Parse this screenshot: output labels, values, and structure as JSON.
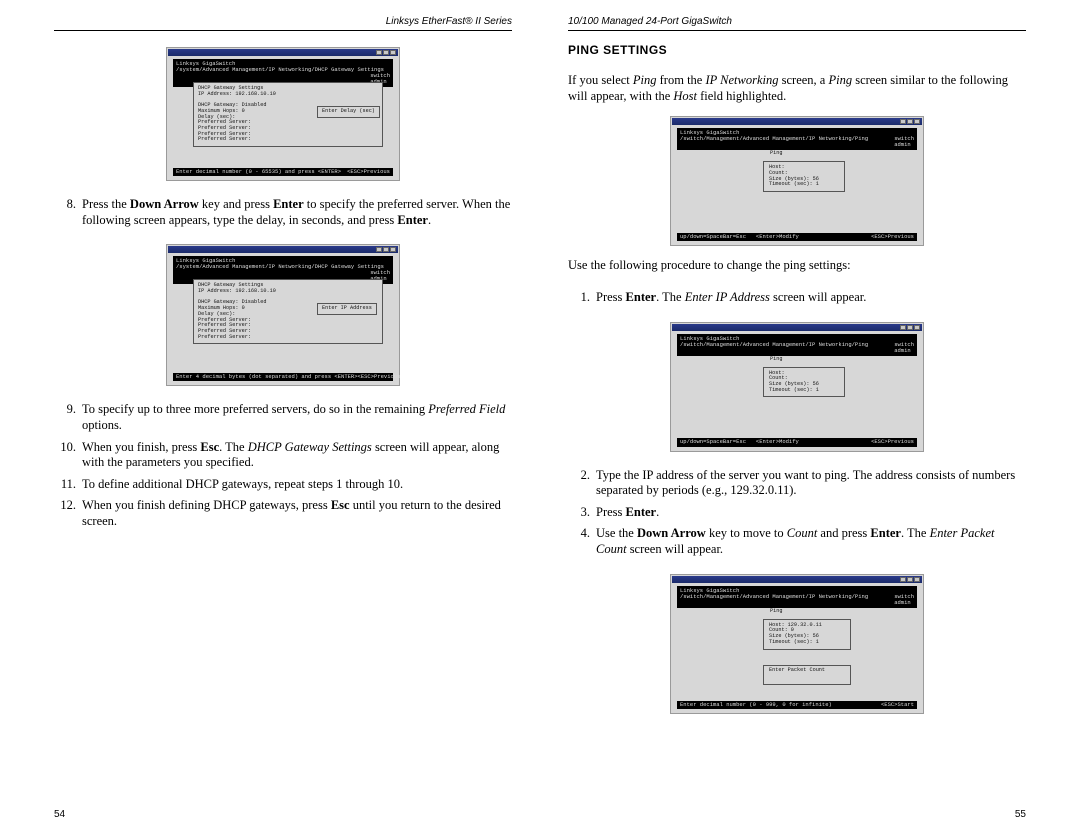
{
  "left": {
    "running_head": "Linksys EtherFast® II Series",
    "page_num": "54",
    "shot1": {
      "head_l": "Linksys GigaSwitch\\n/system/Advanced Management/IP Networking/DHCP Gateway Settings",
      "head_r": "switch\\nadmin",
      "box": "DHCP Gateway Settings\\nIP Address: 192.168.10.10\\n\\nDHCP Gateway: Disabled\\nMaximum Hops: 0\\nDelay (sec): \\nPreferred Server:\\nPreferred Server:\\nPreferred Server:\\nPreferred Server:",
      "edit": "Enter Delay (sec)",
      "status_l": "Enter decimal number (0 - 65535) and press <ENTER>",
      "status_r": "<ESC>Previous"
    },
    "step8": "Press the Down Arrow key and press Enter to specify the preferred server. When the following screen appears, type the delay, in seconds, and press Enter.",
    "shot2": {
      "head_l": "Linksys GigaSwitch\\n/system/Advanced Management/IP Networking/DHCP Gateway Settings",
      "head_r": "switch\\nadmin",
      "box": "DHCP Gateway Settings\\nIP Address: 192.168.10.10\\n\\nDHCP Gateway: Disabled\\nMaximum Hops: 0\\nDelay (sec):\\nPreferred Server:\\nPreferred Server:\\nPreferred Server:\\nPreferred Server:",
      "edit": "Enter IP Address",
      "status_l": "Enter 4 decimal bytes (dot separated) and press <ENTER>",
      "status_r": "<ESC>Previous"
    },
    "step9": "To specify up to three more preferred servers, do so in the remaining Preferred Field options.",
    "step10": "When you finish, press Esc. The DHCP Gateway Settings screen will appear, along with the parameters you specified.",
    "step11": "To define additional DHCP gateways, repeat steps 1 through 10.",
    "step12": "When you finish defining DHCP gateways, press Esc until you return to the desired screen."
  },
  "right": {
    "running_head": "10/100 Managed 24-Port GigaSwitch",
    "page_num": "55",
    "title": "PING SETTINGS",
    "intro": "If you select Ping from the IP Networking screen, a Ping screen similar to the following will appear, with the Host field highlighted.",
    "shotA": {
      "head_l": "Linksys GigaSwitch\\n/switch/Management/Advanced Management/IP Networking/Ping",
      "head_r": "switch\\nadmin",
      "group_title": "Ping",
      "box": "Host:\\nCount:\\nSize (bytes): 56\\nTimeout (sec): 1",
      "status_l": "up/down=SpaceBar=Esc   <Enter>Modify",
      "status_r": "<ESC>Previous"
    },
    "lead": "Use the following procedure to change the ping settings:",
    "step1": "Press Enter. The Enter IP Address screen will appear.",
    "shotB": {
      "head_l": "Linksys GigaSwitch\\n/switch/Management/Advanced Management/IP Networking/Ping",
      "head_r": "switch\\nadmin",
      "group_title": "Ping",
      "box": "Host:\\nCount:\\nSize (bytes): 56\\nTimeout (sec): 1",
      "status_l": "up/down=SpaceBar=Esc   <Enter>Modify",
      "status_r": "<ESC>Previous"
    },
    "step2": "Type the IP address of the server you want to ping. The address consists of numbers separated by periods (e.g., 129.32.0.11).",
    "step3": "Press Enter.",
    "step4": "Use the Down Arrow key to move to Count and press Enter. The Enter Packet Count screen will appear.",
    "shotC": {
      "head_l": "Linksys GigaSwitch\\n/switch/Management/Advanced Management/IP Networking/Ping",
      "head_r": "switch\\nadmin",
      "group_title": "Ping",
      "box": "Host: 129.32.0.11\\nCount: 0\\nSize (bytes): 56\\nTimeout (sec): 1",
      "edit": "Enter Packet Count\\n",
      "status_l": "Enter decimal number (0 - 999, 0 for infinite)",
      "status_r": "<ESC>Start"
    }
  }
}
